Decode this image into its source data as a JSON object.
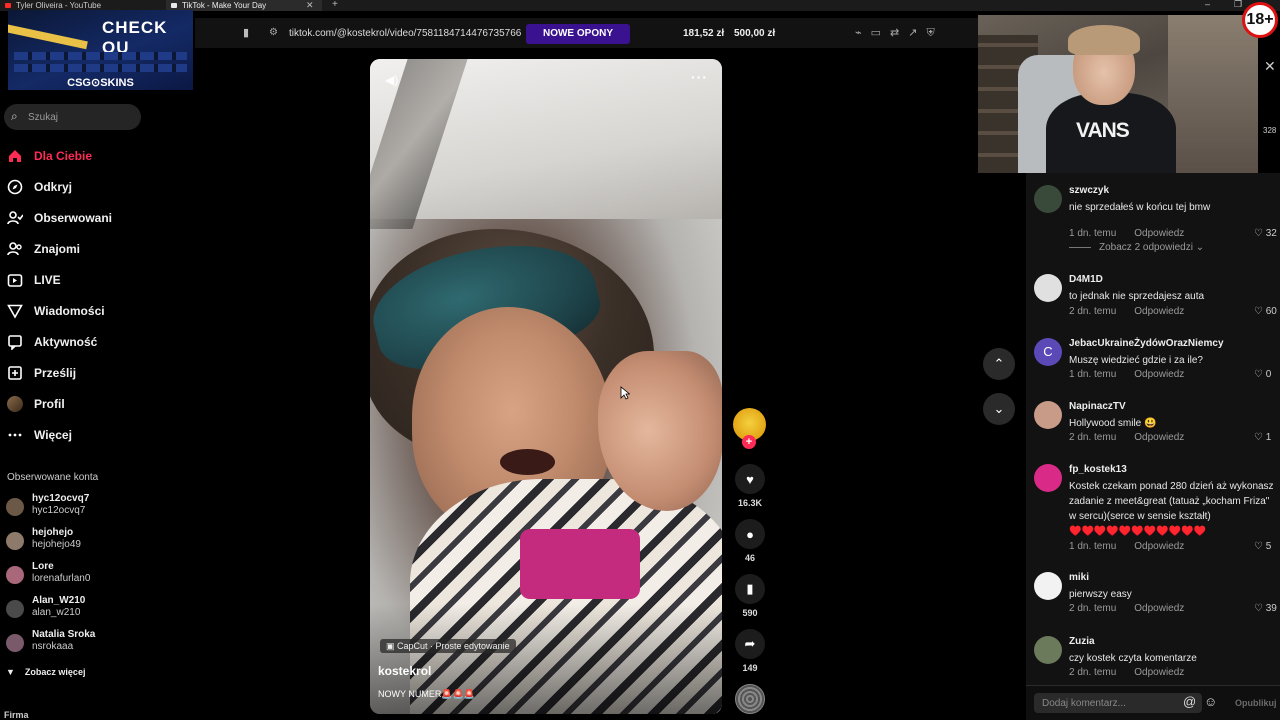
{
  "browser": {
    "tabs": [
      {
        "title": "Tyler Oliveira - YouTube",
        "color": "#ff2a2a"
      },
      {
        "title": "TikTok - Make Your Day",
        "color": "#e9e9e9"
      }
    ],
    "address_url": "tiktok.com/@kostekrol/video/7581184714476735766",
    "promo_label": "NOWE OPONY",
    "price1": "181,52 zł",
    "price2": "500,00 zł"
  },
  "banner": {
    "headline": "CHECK OU",
    "brand": "CSG⊙SKINS"
  },
  "search": {
    "placeholder": "Szukaj"
  },
  "nav": [
    {
      "label": "Dla Ciebie",
      "icon": "home-icon",
      "active": true
    },
    {
      "label": "Odkryj",
      "icon": "compass-icon"
    },
    {
      "label": "Obserwowani",
      "icon": "user-check-icon"
    },
    {
      "label": "Znajomi",
      "icon": "users-icon"
    },
    {
      "label": "LIVE",
      "icon": "live-icon"
    },
    {
      "label": "Wiadomości",
      "icon": "send-icon"
    },
    {
      "label": "Aktywność",
      "icon": "activity-icon"
    },
    {
      "label": "Prześlij",
      "icon": "upload-icon"
    },
    {
      "label": "Profil",
      "icon": "avatar"
    },
    {
      "label": "Więcej",
      "icon": "more-icon"
    }
  ],
  "following": {
    "title": "Obserwowane konta",
    "accounts": [
      {
        "name": "hyc12ocvq7",
        "handle": "hyc12ocvq7",
        "color": "#6b5846"
      },
      {
        "name": "hejohejo",
        "handle": "hejohejo49",
        "color": "#8d7a6a"
      },
      {
        "name": "Lore",
        "handle": "lorenafurlan0",
        "color": "#a8687a"
      },
      {
        "name": "Alan_W210",
        "handle": "alan_w210",
        "color": "#4a4a4a"
      },
      {
        "name": "Natalia Sroka",
        "handle": "nsrokaaa",
        "color": "#7a5a6a"
      }
    ],
    "see_more": "Zobacz więcej"
  },
  "footer_label": "Firma",
  "video": {
    "capcut_label": "CapCut · Proste edytowanie",
    "author": "kostekrol",
    "description": "NOWY NUMER🚨🚨🚨"
  },
  "actions": {
    "likes": "16.3K",
    "comments": "46",
    "saves": "590",
    "shares": "149"
  },
  "webcam": {
    "shirt_text": "VANS",
    "age_badge": "18+",
    "side_count": "328"
  },
  "comments": [
    {
      "user": "szwczyk",
      "text": "nie sprzedałeś w końcu tej bmw",
      "time": "1 dn. temu",
      "reply": "Odpowiedz",
      "likes": "32",
      "avatar_color": "#3a4a3a"
    },
    {
      "user": "D4M1D",
      "text": "to jednak nie sprzedajesz auta",
      "time": "2 dn. temu",
      "reply": "Odpowiedz",
      "likes": "60",
      "avatar_color": "#e0e0e0"
    },
    {
      "user": "JebacUkraineŻydówOrazNiemcy",
      "text": "Muszę wiedzieć gdzie i za ile?",
      "time": "1 dn. temu",
      "reply": "Odpowiedz",
      "likes": "0",
      "avatar_color": "#5b49b8",
      "initial": "C"
    },
    {
      "user": "NapinaczTV",
      "text": "Hollywood smile 😃",
      "time": "2 dn. temu",
      "reply": "Odpowiedz",
      "likes": "1",
      "avatar_color": "#c89a88"
    },
    {
      "user": "fp_kostek13",
      "text": "Kostek czekam ponad 280 dzień aż wykonasz zadanie z meet&great (tatuaż „kocham Friza\" w sercu)(serce w sensie kształt) ♥️♥️♥️♥️♥️♥️♥️♥️♥️♥️♥️",
      "time": "1 dn. temu",
      "reply": "Odpowiedz",
      "likes": "5",
      "avatar_color": "#d82a86"
    },
    {
      "user": "miki",
      "text": "pierwszy easy",
      "time": "2 dn. temu",
      "reply": "Odpowiedz",
      "likes": "39",
      "avatar_color": "#f2f2f2"
    },
    {
      "user": "Zuzia",
      "text": "czy kostek czyta komentarze",
      "time": "2 dn. temu",
      "reply": "Odpowiedz",
      "likes": "",
      "avatar_color": "#6a7a5a"
    }
  ],
  "see_replies": "Zobacz 2 odpowiedzi",
  "compose": {
    "placeholder": "Dodaj komentarz...",
    "post_label": "Opublikuj"
  },
  "colors": {
    "accent": "#fe2c55",
    "promo": "#3a1290",
    "bg": "#000000"
  }
}
